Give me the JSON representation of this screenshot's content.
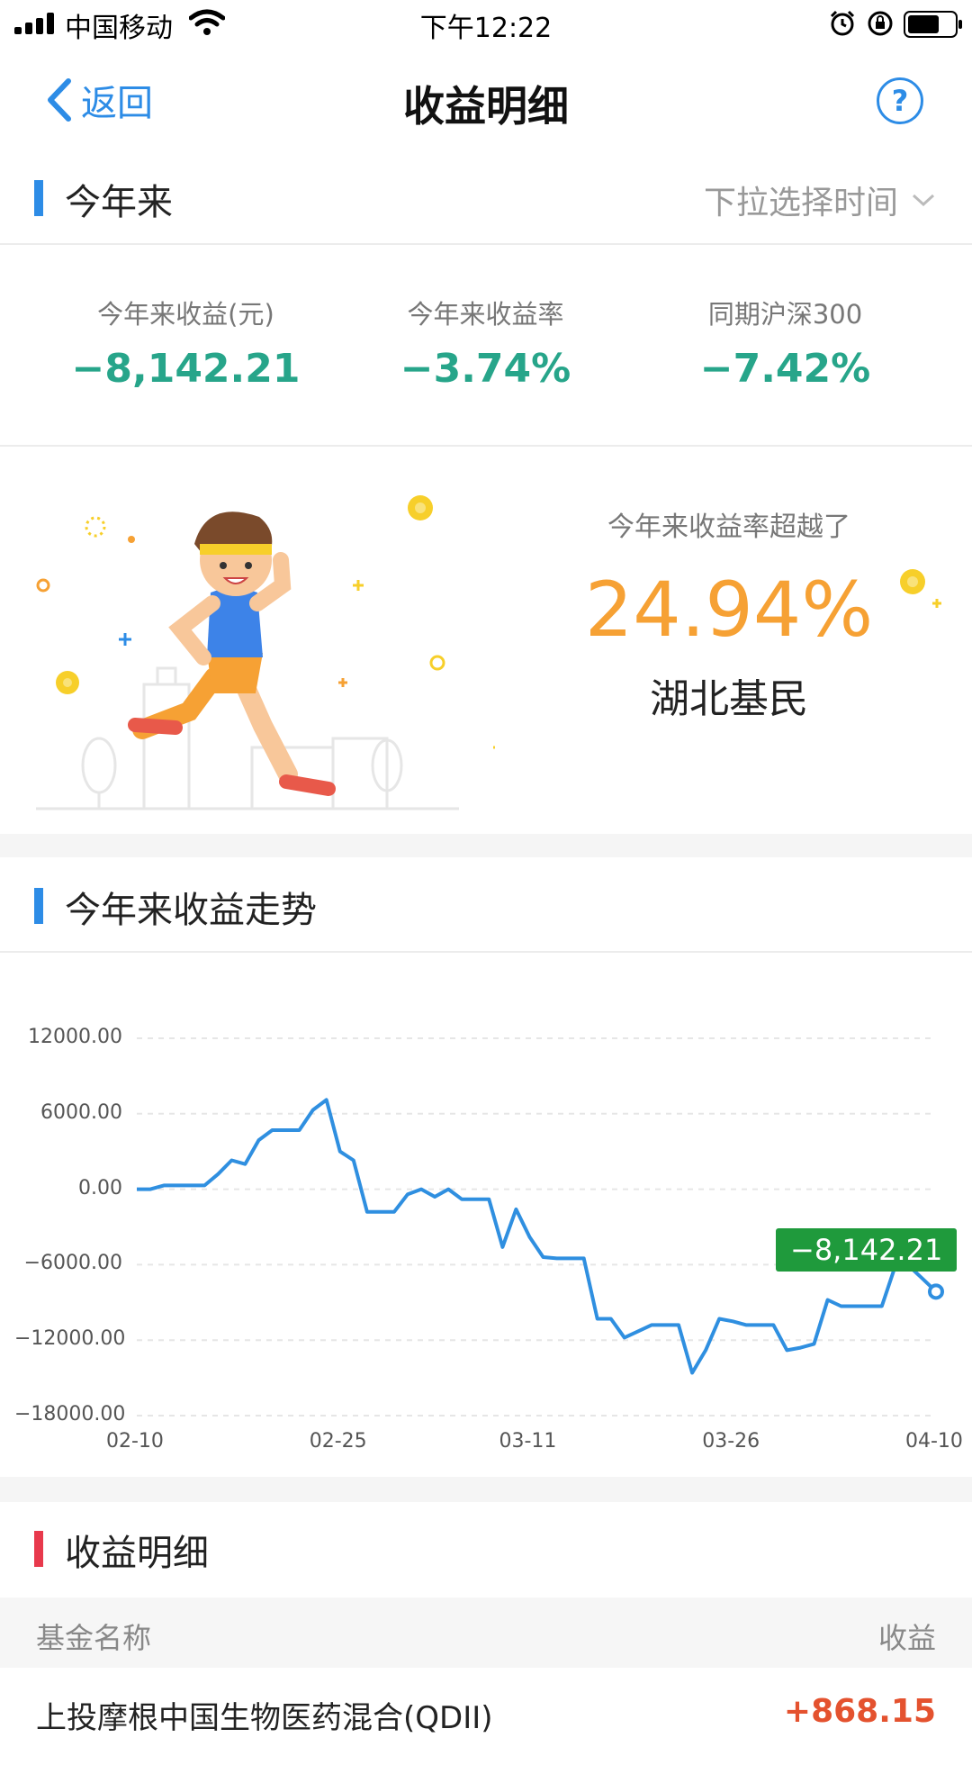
{
  "status_bar": {
    "carrier": "中国移动",
    "time": "下午12:22"
  },
  "nav": {
    "back_label": "返回",
    "title": "收益明细",
    "help_label": "?"
  },
  "period": {
    "title": "今年来",
    "select_label": "下拉选择时间",
    "accent": "#2d8ce6"
  },
  "stats": [
    {
      "label": "今年来收益(元)",
      "value": "−8,142.21"
    },
    {
      "label": "今年来收益率",
      "value": "−3.74%"
    },
    {
      "label": "同期沪深300",
      "value": "−7.42%"
    }
  ],
  "beat": {
    "label": "今年来收益率超越了",
    "percent": "24.94%",
    "who": "湖北基民"
  },
  "trend": {
    "title": "今年来收益走势",
    "current_tag": "−8,142.21"
  },
  "chart_data": {
    "type": "line",
    "y_ticks": [
      "12000.00",
      "6000.00",
      "0.00",
      "−6000.00",
      "−12000.00",
      "−18000.00"
    ],
    "x_ticks": [
      "02-10",
      "02-25",
      "03-11",
      "03-26",
      "04-10"
    ],
    "ylim": [
      -18000,
      12000
    ],
    "series": [
      {
        "color": "#2f8fe0",
        "x": [
          "02-10",
          "02-11",
          "02-12",
          "02-13",
          "02-14",
          "02-15",
          "02-16",
          "02-17",
          "02-18",
          "02-19",
          "02-20",
          "02-21",
          "02-22",
          "02-23",
          "02-24",
          "02-25",
          "02-26",
          "02-27",
          "02-28",
          "03-01",
          "03-02",
          "03-03",
          "03-04",
          "03-05",
          "03-06",
          "03-07",
          "03-08",
          "03-09",
          "03-10",
          "03-11",
          "03-12",
          "03-13",
          "03-14",
          "03-15",
          "03-16",
          "03-17",
          "03-18",
          "03-19",
          "03-20",
          "03-21",
          "03-22",
          "03-23",
          "03-24",
          "03-25",
          "03-26",
          "03-27",
          "03-28",
          "03-29",
          "03-30",
          "03-31",
          "04-01",
          "04-02",
          "04-03",
          "04-04",
          "04-05",
          "04-06",
          "04-07",
          "04-08",
          "04-09",
          "04-10"
        ],
        "values": [
          0,
          0,
          300,
          300,
          300,
          300,
          1200,
          2300,
          2000,
          3900,
          4700,
          4700,
          4700,
          6300,
          7100,
          3000,
          2300,
          -1800,
          -1800,
          -1800,
          -400,
          0,
          -600,
          0,
          -800,
          -800,
          -800,
          -4600,
          -1600,
          -3800,
          -5400,
          -5500,
          -5500,
          -5500,
          -10300,
          -10300,
          -11800,
          -11300,
          -10800,
          -10800,
          -10800,
          -14600,
          -12800,
          -10300,
          -10500,
          -10800,
          -10800,
          -10800,
          -12800,
          -12600,
          -12300,
          -8800,
          -9300,
          -9300,
          -9300,
          -9300,
          -6100,
          -6100,
          -7100,
          -8142.21
        ]
      }
    ]
  },
  "details": {
    "title": "收益明细",
    "accent": "#e8394c",
    "columns": {
      "name": "基金名称",
      "gain": "收益"
    },
    "rows": [
      {
        "name": "上投摩根中国生物医药混合(QDII)",
        "gain": "+868.15"
      }
    ]
  }
}
